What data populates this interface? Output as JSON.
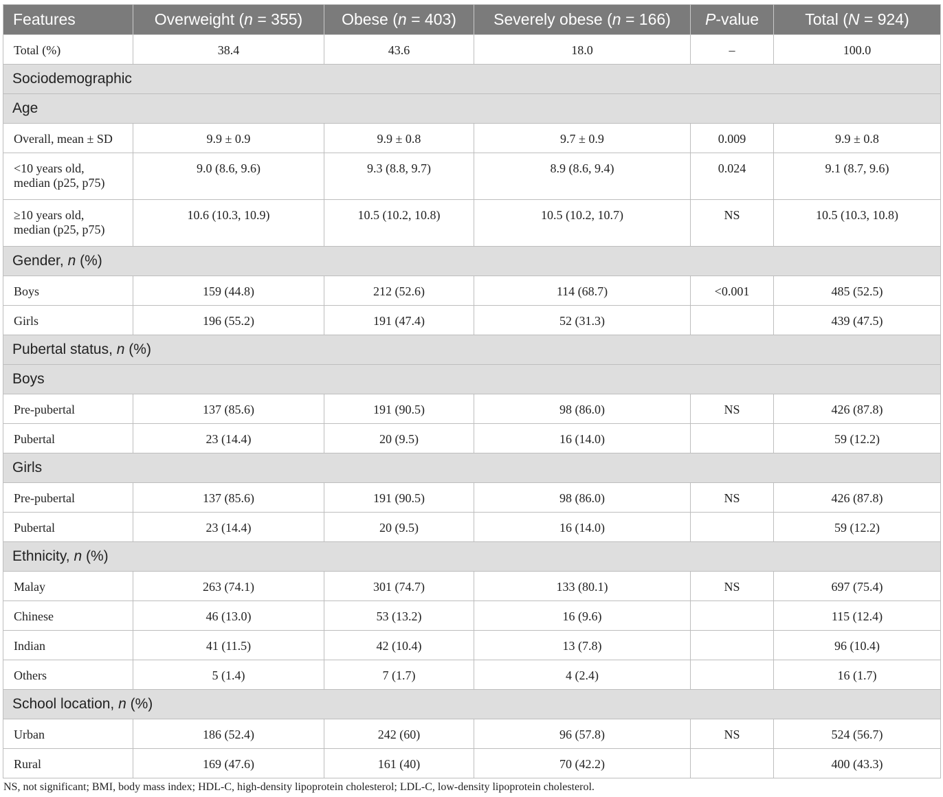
{
  "header": {
    "features": "Features",
    "overweight_pre": "Overweight (",
    "overweight_n": "n",
    "overweight_post": " = 355)",
    "obese_pre": "Obese (",
    "obese_n": "n",
    "obese_post": " = 403)",
    "severe_pre": "Severely obese (",
    "severe_n": "n",
    "severe_post": " = 166)",
    "pvalue_p": "P",
    "pvalue_post": "-value",
    "total_pre": "Total (",
    "total_n": "N",
    "total_post": " = 924)"
  },
  "rows": {
    "total": [
      "Total (%)",
      "38.4",
      "43.6",
      "18.0",
      "–",
      "100.0"
    ],
    "sec_sociodemographic": "Sociodemographic",
    "sec_age": "Age",
    "age_overall": [
      "Overall, mean ± SD",
      "9.9 ± 0.9",
      "9.9 ± 0.8",
      "9.7 ± 0.9",
      "0.009",
      "9.9 ± 0.8"
    ],
    "age_under10": [
      "<10 years old,",
      "median (p25, p75)",
      "9.0 (8.6, 9.6)",
      "9.3 (8.8, 9.7)",
      "8.9 (8.6, 9.4)",
      "0.024",
      "9.1 (8.7, 9.6)"
    ],
    "age_over10": [
      "≥10 years old,",
      "median (p25, p75)",
      "10.6 (10.3, 10.9)",
      "10.5 (10.2, 10.8)",
      "10.5 (10.2, 10.7)",
      "NS",
      "10.5 (10.3, 10.8)"
    ],
    "sec_gender_pre": "Gender, ",
    "sec_gender_n": "n",
    "sec_gender_post": " (%)",
    "gender_boys": [
      "Boys",
      "159 (44.8)",
      "212 (52.6)",
      "114 (68.7)",
      "<0.001",
      "485 (52.5)"
    ],
    "gender_girls": [
      "Girls",
      "196 (55.2)",
      "191 (47.4)",
      "52 (31.3)",
      "",
      "439 (47.5)"
    ],
    "sec_pubertal_pre": "Pubertal status, ",
    "sec_pubertal_n": "n",
    "sec_pubertal_post": " (%)",
    "sec_boys": "Boys",
    "boys_pre": [
      "Pre-pubertal",
      "137 (85.6)",
      "191 (90.5)",
      "98 (86.0)",
      "NS",
      "426 (87.8)"
    ],
    "boys_pub": [
      "Pubertal",
      "23 (14.4)",
      "20 (9.5)",
      "16 (14.0)",
      "",
      "59 (12.2)"
    ],
    "sec_girls": "Girls",
    "girls_pre": [
      "Pre-pubertal",
      "137 (85.6)",
      "191 (90.5)",
      "98 (86.0)",
      "NS",
      "426 (87.8)"
    ],
    "girls_pub": [
      "Pubertal",
      "23 (14.4)",
      "20 (9.5)",
      "16 (14.0)",
      "",
      "59 (12.2)"
    ],
    "sec_ethnicity_pre": "Ethnicity, ",
    "sec_ethnicity_n": "n",
    "sec_ethnicity_post": " (%)",
    "eth_malay": [
      "Malay",
      "263 (74.1)",
      "301 (74.7)",
      "133 (80.1)",
      "NS",
      "697 (75.4)"
    ],
    "eth_chinese": [
      "Chinese",
      "46 (13.0)",
      "53 (13.2)",
      "16 (9.6)",
      "",
      "115 (12.4)"
    ],
    "eth_indian": [
      "Indian",
      "41 (11.5)",
      "42 (10.4)",
      "13 (7.8)",
      "",
      "96 (10.4)"
    ],
    "eth_others": [
      "Others",
      "5 (1.4)",
      "7 (1.7)",
      "4 (2.4)",
      "",
      "16 (1.7)"
    ],
    "sec_school_pre": "School location, ",
    "sec_school_n": "n",
    "sec_school_post": " (%)",
    "school_urban": [
      "Urban",
      "186 (52.4)",
      "242 (60)",
      "96 (57.8)",
      "NS",
      "524 (56.7)"
    ],
    "school_rural": [
      "Rural",
      "169 (47.6)",
      "161 (40)",
      "70 (42.2)",
      "",
      "400 (43.3)"
    ]
  },
  "footnote": "NS, not significant; BMI, body mass index; HDL-C, high-density lipoprotein cholesterol; LDL-C, low-density lipoprotein cholesterol."
}
